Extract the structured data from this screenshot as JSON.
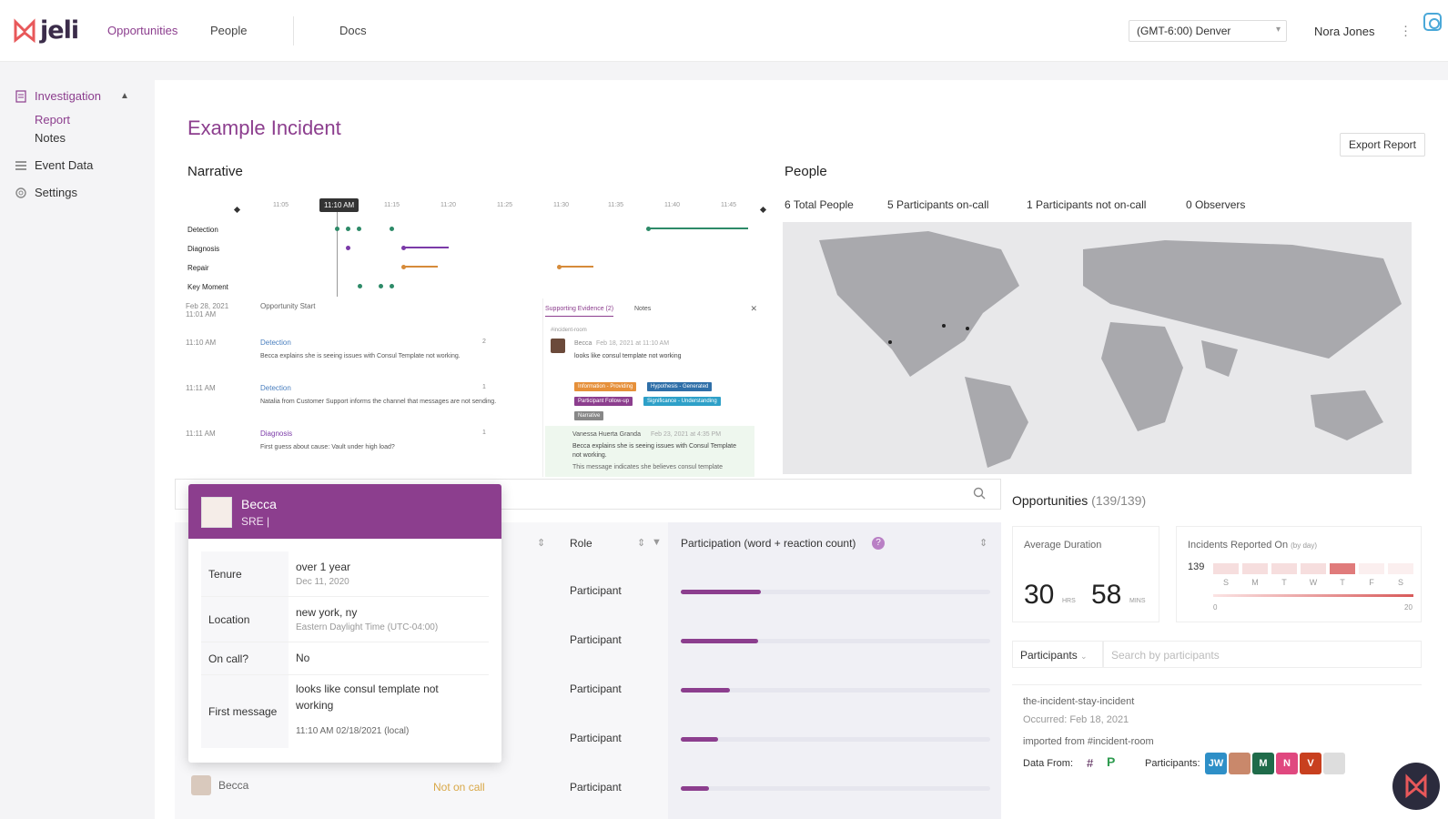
{
  "app": {
    "logo_text": "jeli"
  },
  "nav": {
    "opportunities": "Opportunities",
    "people": "People",
    "docs": "Docs"
  },
  "header": {
    "timezone": "(GMT-6:00) Denver",
    "user_name": "Nora Jones"
  },
  "sidebar": {
    "investigation": "Investigation",
    "report": "Report",
    "notes": "Notes",
    "event_data": "Event Data",
    "settings": "Settings"
  },
  "page": {
    "title": "Example Incident",
    "export_label": "Export Report",
    "narrative_title": "Narrative",
    "people_title": "People"
  },
  "timeline": {
    "cursor_label": "11:10 AM",
    "ticks": [
      "11:05",
      "11:10",
      "11:15",
      "11:20",
      "11:25",
      "11:30",
      "11:35",
      "11:40",
      "11:45"
    ],
    "rows": [
      "Detection",
      "Diagnosis",
      "Repair",
      "Key Moment"
    ]
  },
  "events": [
    {
      "time": "Feb 28, 2021\n11:01 AM",
      "type": "Opportunity Start",
      "desc": "",
      "meta": ""
    },
    {
      "time": "11:10 AM",
      "type": "Detection",
      "desc": "Becca explains she is seeing issues with Consul Template not working.",
      "meta": "2"
    },
    {
      "time": "11:11 AM",
      "type": "Detection",
      "desc": "Natalia from Customer Support informs the channel that messages are not sending.",
      "meta": "1"
    },
    {
      "time": "11:11 AM",
      "type": "Diagnosis",
      "desc": "First guess about cause: Vault under high load?",
      "meta": "1"
    }
  ],
  "evidence": {
    "tab_supporting": "Supporting Evidence (2)",
    "tab_notes": "Notes",
    "channel": "#incident-room",
    "msg1_author": "Becca",
    "msg1_time": "Feb 18, 2021 at 11:10 AM",
    "msg1_text": "looks like consul template not working",
    "chips": [
      "Information - Providing",
      "Hypothesis - Generated",
      "Participant Follow-up",
      "Significance - Understanding",
      "Narrative"
    ],
    "msg2_author": "Vanessa Huerta Granda",
    "msg2_time": "Feb 23, 2021 at 4:35 PM",
    "msg2_text": "Becca explains she is seeing issues with Consul Template not working.",
    "msg2_more": "This message indicates she believes consul template"
  },
  "people_stats": {
    "total": "6",
    "total_label": "Total People",
    "oncall": "5",
    "oncall_label": "Participants on-call",
    "notoncall": "1",
    "notoncall_label": "Participants not on-call",
    "observers": "0",
    "observers_label": "Observers"
  },
  "table": {
    "col_role": "Role",
    "col_participation": "Participation (word + reaction count)",
    "rows": [
      {
        "role": "Participant",
        "fill": 0.26
      },
      {
        "role": "Participant",
        "fill": 0.25
      },
      {
        "role": "Participant",
        "fill": 0.16
      },
      {
        "role": "Participant",
        "fill": 0.12
      },
      {
        "role": "Participant",
        "fill": 0.09,
        "name": "Becca",
        "status": "Not on call"
      }
    ]
  },
  "popover": {
    "name": "Becca",
    "role": "SRE |",
    "tenure_key": "Tenure",
    "tenure_val": "over 1 year",
    "tenure_sub": "Dec 11, 2020",
    "location_key": "Location",
    "location_val": "new york, ny",
    "location_sub": "Eastern Daylight Time (UTC-04:00)",
    "oncall_key": "On call?",
    "oncall_val": "No",
    "first_key": "First message",
    "first_val_1": "looks like consul template not",
    "first_val_2": "working",
    "first_sub": "11:10 AM 02/18/2021 (local)"
  },
  "opportunities": {
    "title": "Opportunities",
    "count": "(139/139)",
    "avg_label": "Average Duration",
    "hrs": "30",
    "hrs_unit": "HRS",
    "mins": "58",
    "mins_unit": "MINS",
    "reported_label": "Incidents Reported On",
    "reported_sub": "(by day)",
    "reported_total": "139",
    "days": [
      "S",
      "M",
      "T",
      "W",
      "T",
      "F",
      "S"
    ],
    "scale_min": "0",
    "scale_max": "20",
    "filter_label": "Participants",
    "search_placeholder": "Search by participants"
  },
  "incident": {
    "name": "the-incident-stay-incident",
    "occurred": "Occurred: Feb 18, 2021",
    "imported": "imported from #incident-room",
    "data_from": "Data From:",
    "participants": "Participants:",
    "chips": [
      "JW",
      "",
      "M",
      "N",
      "V",
      ""
    ]
  },
  "colors": {
    "brand": "#8c3e8e",
    "green": "#2d8a68",
    "orange": "#d68b3a"
  }
}
